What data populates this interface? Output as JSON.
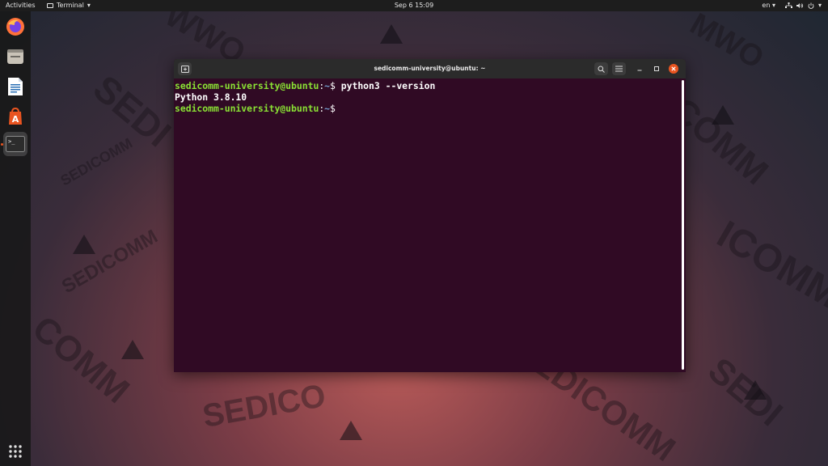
{
  "topbar": {
    "activities": "Activities",
    "app_menu": "Terminal",
    "clock": "Sep 6  15:09",
    "keyboard_layout": "en"
  },
  "dock": {
    "items": [
      {
        "icon": "firefox-icon"
      },
      {
        "icon": "files-icon"
      },
      {
        "icon": "libreoffice-writer-icon"
      },
      {
        "icon": "software-center-icon"
      },
      {
        "icon": "terminal-icon",
        "active": true
      }
    ],
    "show_apps_icon": "show-applications-icon"
  },
  "window": {
    "title": "sedicomm-university@ubuntu: ~",
    "lines": [
      {
        "user": "sedicomm-university@ubuntu",
        "sep": ":",
        "path": "~",
        "prompt": "$ ",
        "command": "python3 --version"
      },
      {
        "output": "Python 3.8.10"
      },
      {
        "user": "sedicomm-university@ubuntu",
        "sep": ":",
        "path": "~",
        "prompt": "$ ",
        "command": ""
      }
    ]
  },
  "wallpaper": {
    "brand": "SEDICOMM",
    "fragments": [
      "WWO",
      "SEDI",
      "SEDICOMM",
      "COMM",
      "MWO",
      "SEDICOMM",
      "ICOMM",
      "SEDICO",
      "SEDICOMM",
      "COMM",
      "SEDI"
    ]
  },
  "colors": {
    "terminal_bg": "#300a24",
    "prompt_user": "#8ae234",
    "prompt_path": "#729fcf",
    "accent": "#e95420"
  }
}
